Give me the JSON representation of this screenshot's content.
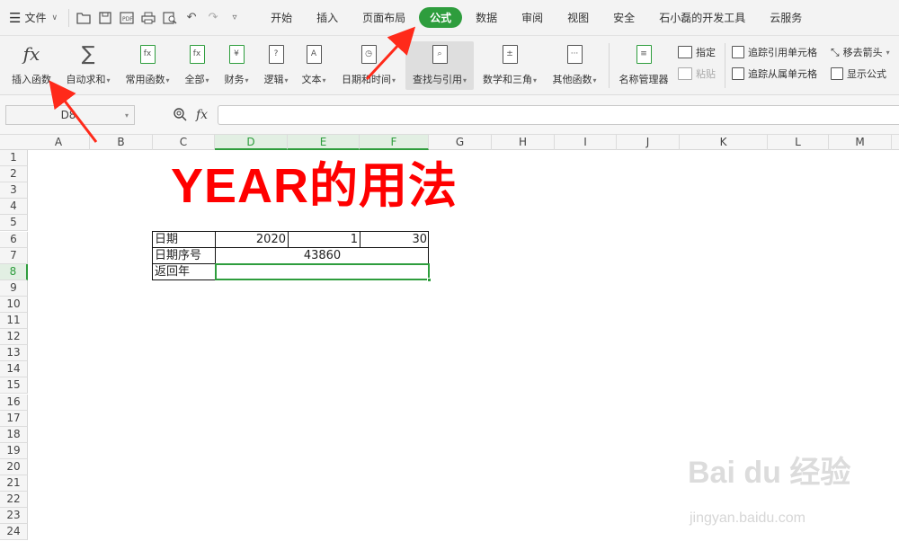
{
  "menubar": {
    "file_label": "文件",
    "tabs": [
      {
        "label": "开始"
      },
      {
        "label": "插入"
      },
      {
        "label": "页面布局"
      },
      {
        "label": "公式",
        "active": true
      },
      {
        "label": "数据"
      },
      {
        "label": "审阅"
      },
      {
        "label": "视图"
      },
      {
        "label": "安全"
      },
      {
        "label": "石小磊的开发工具"
      },
      {
        "label": "云服务"
      }
    ],
    "active_color": "#2e9d3d"
  },
  "ribbon": {
    "insert_function": "插入函数",
    "autosum": "自动求和",
    "common_functions": "常用函数",
    "all": "全部",
    "financial": "财务",
    "logical": "逻辑",
    "text": "文本",
    "datetime": "日期和时间",
    "lookup": "查找与引用",
    "math": "数学和三角",
    "other": "其他函数",
    "name_manager": "名称管理器",
    "define": "指定",
    "paste": "粘贴",
    "trace_precedents": "追踪引用单元格",
    "trace_dependents": "追踪从属单元格",
    "remove_arrows": "移去箭头",
    "show_formulas": "显示公式"
  },
  "formula_bar": {
    "name_box": "D8",
    "fx_label": "fx",
    "formula": ""
  },
  "grid": {
    "columns": [
      "A",
      "B",
      "C",
      "D",
      "E",
      "F",
      "G",
      "H",
      "I",
      "J",
      "K",
      "L",
      "M"
    ],
    "rows": [
      "1",
      "2",
      "3",
      "4",
      "5",
      "6",
      "7",
      "8",
      "9",
      "10",
      "11",
      "12",
      "13",
      "14",
      "15",
      "16",
      "17",
      "18",
      "19",
      "20",
      "21",
      "22",
      "23",
      "24"
    ],
    "title": "YEAR的用法",
    "cells": {
      "C6": "日期",
      "D6": "2020",
      "E6": "1",
      "F6": "30",
      "C7": "日期序号",
      "D7": "43860",
      "C8": "返回年"
    },
    "selected_cell": "D8"
  },
  "watermark": {
    "brand": "Bai du 经验",
    "url": "jingyan.baidu.com"
  },
  "colors": {
    "accent": "#2e9d3d",
    "title": "#ff0000",
    "arrow": "#ff2a1a"
  }
}
